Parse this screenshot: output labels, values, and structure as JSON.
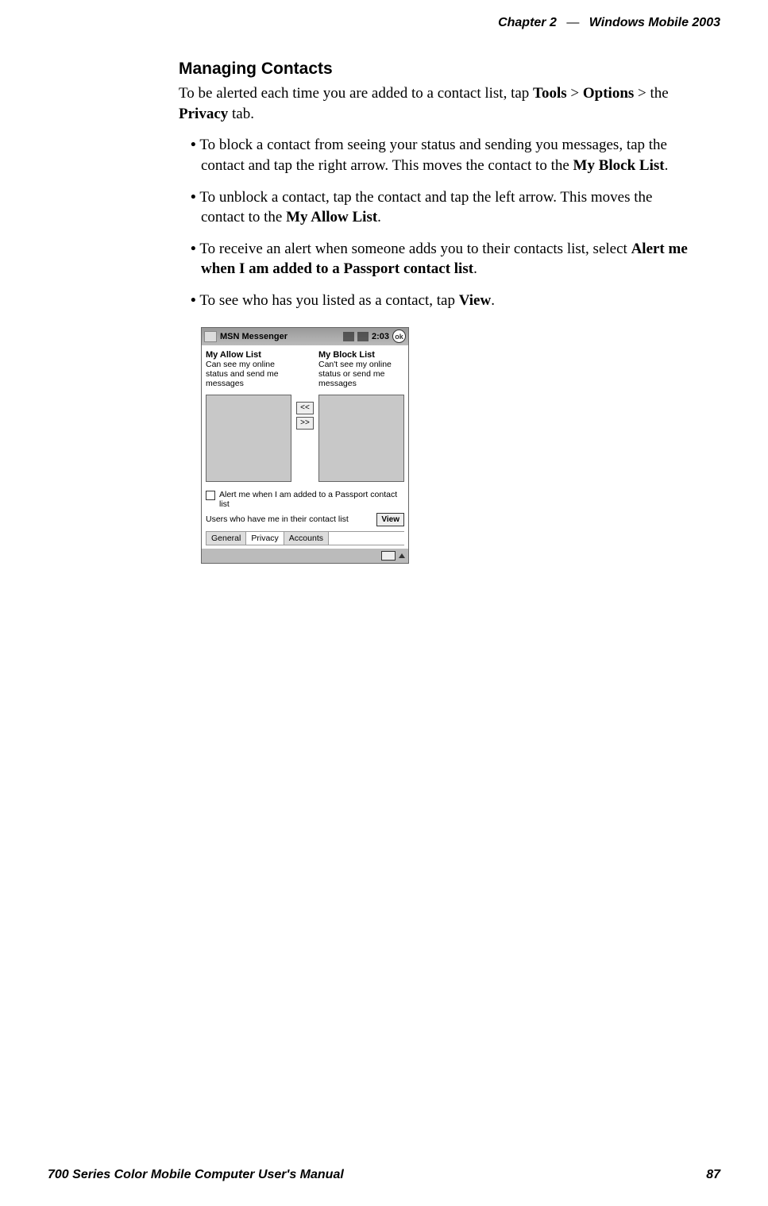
{
  "header": {
    "chapter": "Chapter",
    "chapter_num": "2",
    "dash": "—",
    "title": "Windows Mobile 2003"
  },
  "heading": "Managing Contacts",
  "intro": {
    "t1": "To be alerted each time you are added to a contact list, tap ",
    "b1": "Tools",
    "gt1": " > ",
    "b2": "Op­tions",
    "gt2": " > the ",
    "b3": "Privacy",
    "t2": " tab."
  },
  "bullets": [
    {
      "t1": "To block a contact from seeing your status and sending you messages, tap the contact and tap the right arrow. This moves the contact to the ",
      "b1": "My Block List",
      "t2": "."
    },
    {
      "t1": "To unblock a contact, tap the contact and tap the left arrow. This moves the contact to the ",
      "b1": "My Allow List",
      "t2": "."
    },
    {
      "t1": "To receive an alert when someone adds you to their contacts list, select ",
      "b1": "Alert me when I am added to a Passport contact list",
      "t2": "."
    },
    {
      "t1": "To see who has you listed as a contact, tap ",
      "b1": "View",
      "t2": "."
    }
  ],
  "pda": {
    "app": "MSN Messenger",
    "time": "2:03",
    "ok": "ok",
    "allow": {
      "label": "My Allow List",
      "sub": "Can see my online status and send me messages"
    },
    "block": {
      "label": "My Block List",
      "sub": "Can't see my online status or send me messages"
    },
    "arrows": {
      "left": "<<",
      "right": ">>"
    },
    "alert": "Alert me when I am added to a Passport contact list",
    "users": "Users who have me in their contact list",
    "view": "View",
    "tabs": {
      "general": "General",
      "privacy": "Privacy",
      "accounts": "Accounts"
    }
  },
  "footer": {
    "manual": "700 Series Color Mobile Computer User's Manual",
    "page": "87"
  }
}
